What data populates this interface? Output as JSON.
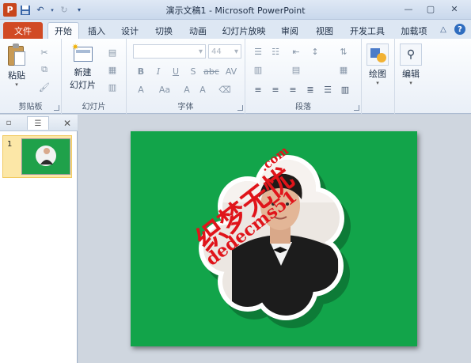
{
  "titlebar": {
    "app_title": "演示文稿1 - Microsoft PowerPoint",
    "app_icon": "powerpoint-logo",
    "qat_icons": [
      "save-icon",
      "undo-icon",
      "redo-icon",
      "customize-icon"
    ],
    "window_controls": [
      "minimize-icon",
      "restore-icon",
      "close-icon"
    ]
  },
  "tabs": {
    "file": "文件",
    "home": "开始",
    "insert": "插入",
    "design": "设计",
    "transitions": "切换",
    "animations": "动画",
    "slideshow": "幻灯片放映",
    "review": "审阅",
    "view": "视图",
    "developer": "开发工具",
    "addins": "加载项"
  },
  "ribbon": {
    "clipboard": {
      "paste": "粘贴",
      "label": "剪贴板"
    },
    "slides": {
      "new_slide_line1": "新建",
      "new_slide_line2": "幻灯片",
      "label": "幻灯片"
    },
    "font": {
      "size": "44",
      "label": "字体",
      "bold": "B",
      "italic": "I",
      "underline": "U",
      "strike": "S",
      "strike_abc": "abc",
      "aa": "Aa"
    },
    "paragraph": {
      "label": "段落"
    },
    "drawing": {
      "label": "绘图"
    },
    "editing": {
      "label": "编辑"
    }
  },
  "pane": {
    "slide_number": "1"
  },
  "watermark": {
    "chinese": "织梦无忧",
    "suffix": ".com",
    "domain": "dedecms51"
  },
  "colors": {
    "file_tab": "#d14a24",
    "slide_bg": "#12a44a",
    "watermark": "#e0141a",
    "thumb_selected": "#fce7a7"
  }
}
